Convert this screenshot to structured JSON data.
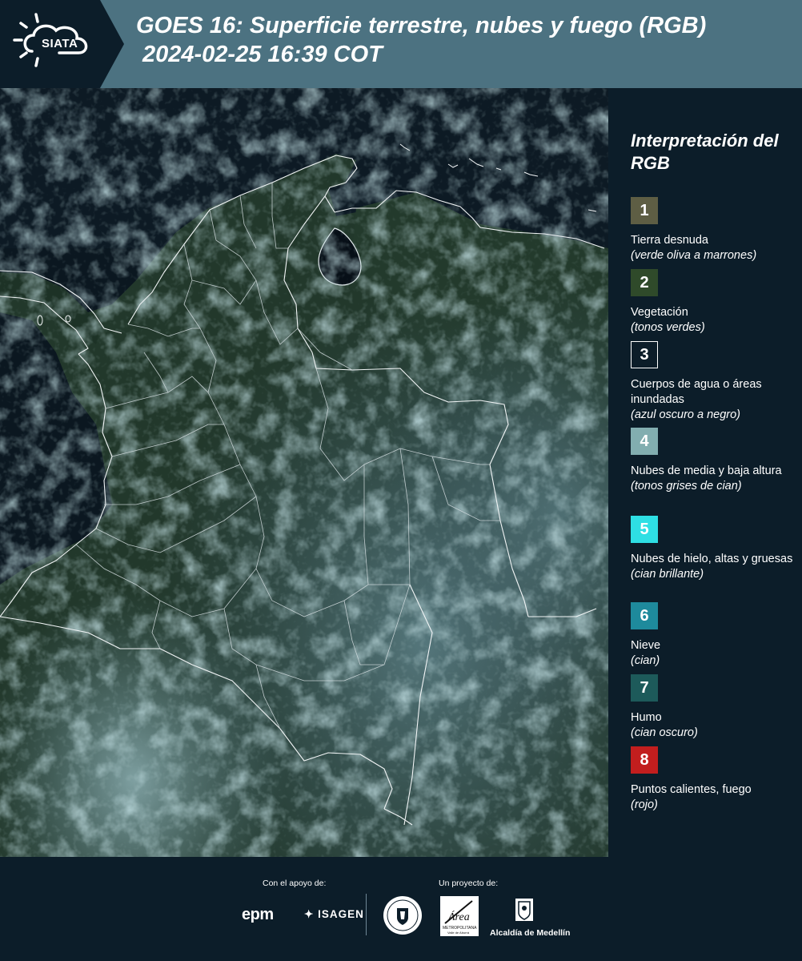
{
  "header": {
    "logo_text": "SIATA",
    "title_line1": "GOES 16: Superficie terrestre, nubes y fuego (RGB)",
    "title_line2": "2024-02-25 16:39 COT"
  },
  "legend": {
    "title": "Interpretación del RGB",
    "items": [
      {
        "number": "1",
        "label": "Tierra desnuda",
        "note": "(verde oliva a marrones)",
        "color": "#5e5e44"
      },
      {
        "number": "2",
        "label": "Vegetación",
        "note": "(tonos verdes)",
        "color": "#2f4a2a"
      },
      {
        "number": "3",
        "label": "Cuerpos de agua o áreas inundadas",
        "note": "(azul oscuro a negro)",
        "color": "#0c1d29"
      },
      {
        "number": "4",
        "label": "Nubes de media y baja altura",
        "note": "(tonos grises de cian)",
        "color": "#82aeb0"
      },
      {
        "number": "5",
        "label": "Nubes de hielo, altas y gruesas",
        "note": "(cian brillante)",
        "color": "#2edfe4"
      },
      {
        "number": "6",
        "label": "Nieve",
        "note": "(cian)",
        "color": "#1e8a9c"
      },
      {
        "number": "7",
        "label": "Humo",
        "note": "(cian oscuro)",
        "color": "#1d5a5a"
      },
      {
        "number": "8",
        "label": "Puntos calientes, fuego",
        "note": "(rojo)",
        "color": "#c21e1e"
      }
    ]
  },
  "footer": {
    "support_label": "Con el apoyo de:",
    "project_label": "Un proyecto de:",
    "epm": "epm",
    "isagen": "ISAGEN",
    "area_text": "Área",
    "area_sub": "METROPOLITANA",
    "area_sub2": "Valle de Aburrá",
    "alcaldia": "Alcaldía de Medellín"
  }
}
